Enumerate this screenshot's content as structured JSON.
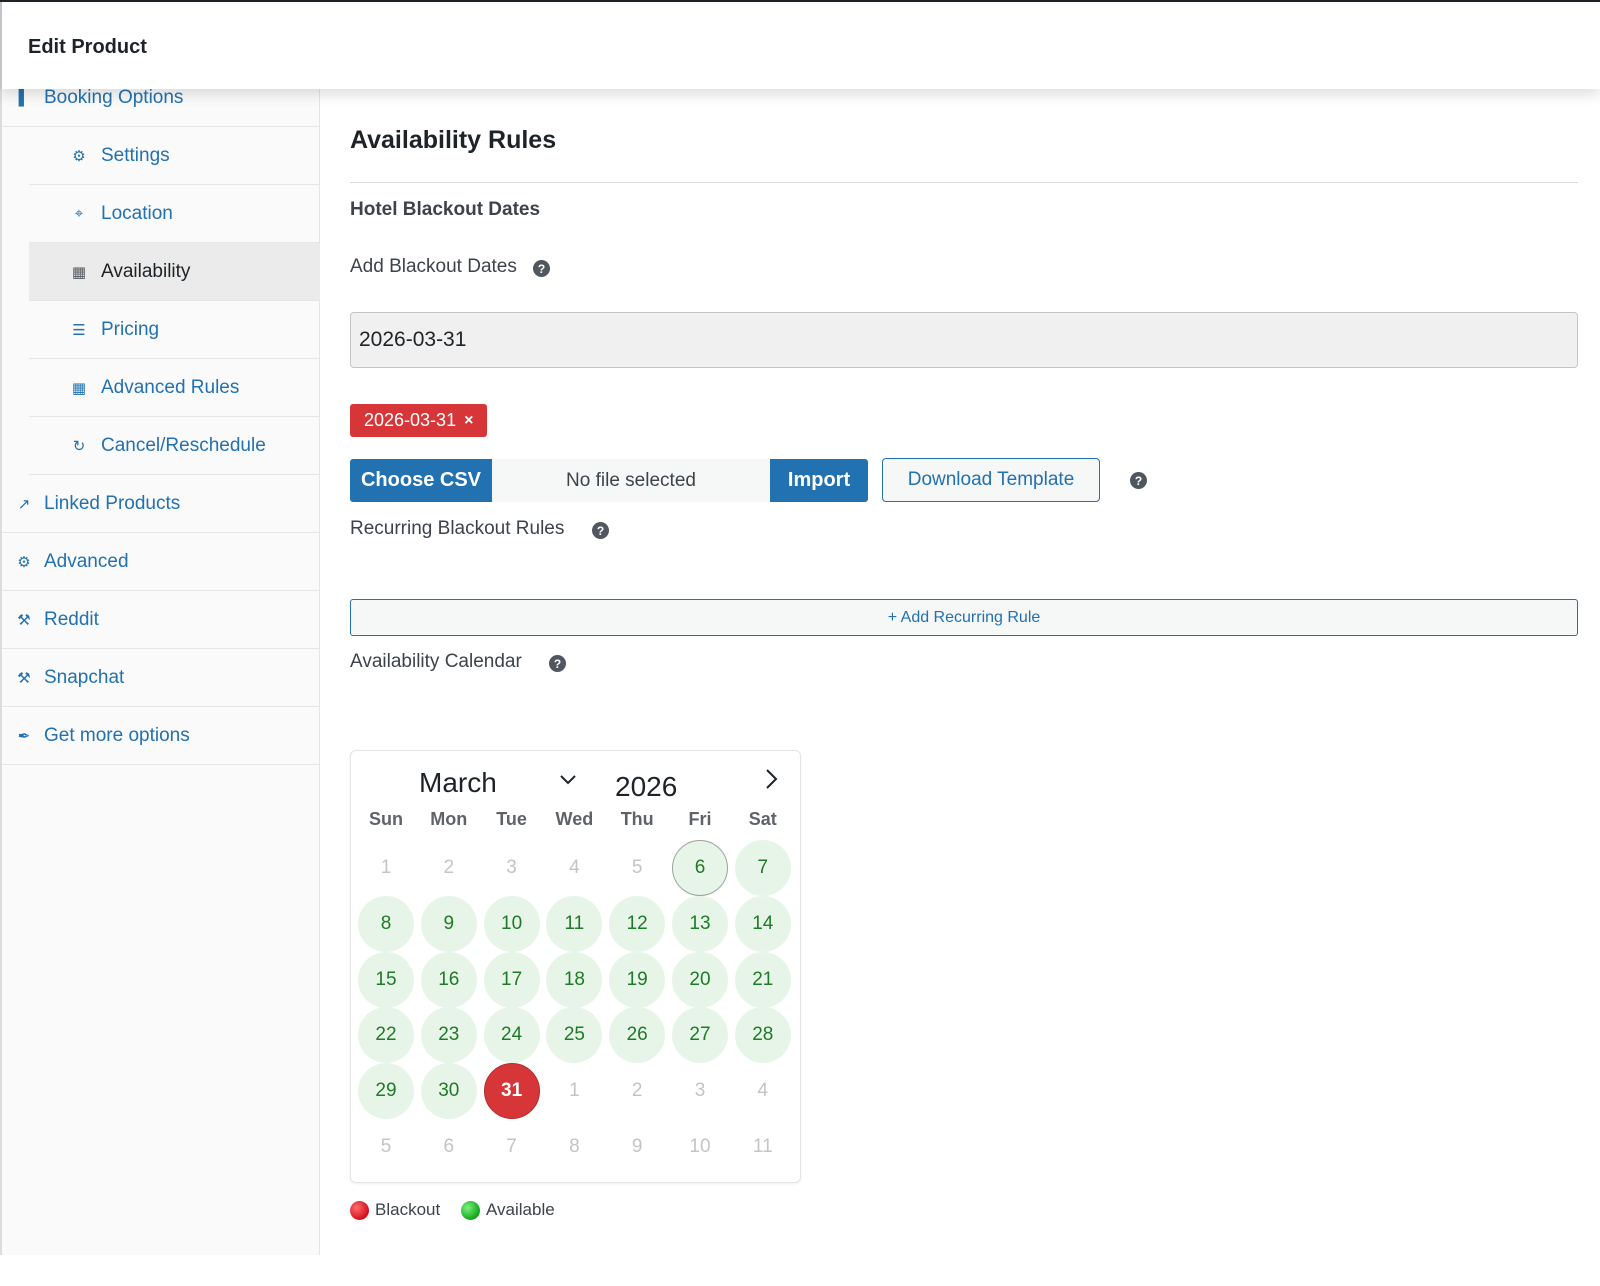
{
  "window": {
    "title": "Edit Product"
  },
  "sidebar": {
    "items": [
      {
        "label": "Booking Options",
        "icon": "book-icon",
        "level": "top"
      },
      {
        "label": "Settings",
        "icon": "gear-icon",
        "level": "sub"
      },
      {
        "label": "Location",
        "icon": "map-pin-icon",
        "level": "sub"
      },
      {
        "label": "Availability",
        "icon": "calendar-icon",
        "level": "sub",
        "active": true
      },
      {
        "label": "Pricing",
        "icon": "list-icon",
        "level": "sub"
      },
      {
        "label": "Advanced Rules",
        "icon": "grid-icon",
        "level": "sub"
      },
      {
        "label": "Cancel/Reschedule",
        "icon": "refresh-icon",
        "level": "sub"
      },
      {
        "label": "Linked Products",
        "icon": "link-icon",
        "level": "top"
      },
      {
        "label": "Advanced",
        "icon": "gear-icon",
        "level": "top"
      },
      {
        "label": "Reddit",
        "icon": "wrench-icon",
        "level": "top"
      },
      {
        "label": "Snapchat",
        "icon": "wrench-icon",
        "level": "top"
      },
      {
        "label": "Get more options",
        "icon": "plugin-icon",
        "level": "top"
      }
    ]
  },
  "main": {
    "section_title": "Availability Rules",
    "subsection_title": "Hotel Blackout Dates",
    "add_blackout_label": "Add Blackout Dates",
    "blackout_input_value": "2026-03-31",
    "blackout_tags": [
      {
        "label": "2026-03-31",
        "remove_symbol": "×"
      }
    ],
    "choose_csv_label": "Choose CSV",
    "file_status": "No file selected",
    "import_label": "Import",
    "download_template_label": "Download Template",
    "recurring_label": "Recurring Blackout Rules",
    "add_recurring_label": "+ Add Recurring Rule",
    "calendar_label": "Availability Calendar",
    "help_symbol": "?"
  },
  "calendar": {
    "month": "March",
    "year": "2026",
    "weekdays": [
      "Sun",
      "Mon",
      "Tue",
      "Wed",
      "Thu",
      "Fri",
      "Sat"
    ],
    "weeks": [
      [
        {
          "d": "1",
          "s": "other"
        },
        {
          "d": "2",
          "s": "other"
        },
        {
          "d": "3",
          "s": "other"
        },
        {
          "d": "4",
          "s": "other"
        },
        {
          "d": "5",
          "s": "other"
        },
        {
          "d": "6",
          "s": "today"
        },
        {
          "d": "7",
          "s": "avail"
        }
      ],
      [
        {
          "d": "8",
          "s": "avail"
        },
        {
          "d": "9",
          "s": "avail"
        },
        {
          "d": "10",
          "s": "avail"
        },
        {
          "d": "11",
          "s": "avail"
        },
        {
          "d": "12",
          "s": "avail"
        },
        {
          "d": "13",
          "s": "avail"
        },
        {
          "d": "14",
          "s": "avail"
        }
      ],
      [
        {
          "d": "15",
          "s": "avail"
        },
        {
          "d": "16",
          "s": "avail"
        },
        {
          "d": "17",
          "s": "avail"
        },
        {
          "d": "18",
          "s": "avail"
        },
        {
          "d": "19",
          "s": "avail"
        },
        {
          "d": "20",
          "s": "avail"
        },
        {
          "d": "21",
          "s": "avail"
        }
      ],
      [
        {
          "d": "22",
          "s": "avail"
        },
        {
          "d": "23",
          "s": "avail"
        },
        {
          "d": "24",
          "s": "avail"
        },
        {
          "d": "25",
          "s": "avail"
        },
        {
          "d": "26",
          "s": "avail"
        },
        {
          "d": "27",
          "s": "avail"
        },
        {
          "d": "28",
          "s": "avail"
        }
      ],
      [
        {
          "d": "29",
          "s": "avail"
        },
        {
          "d": "30",
          "s": "avail"
        },
        {
          "d": "31",
          "s": "blackout"
        },
        {
          "d": "1",
          "s": "other"
        },
        {
          "d": "2",
          "s": "other"
        },
        {
          "d": "3",
          "s": "other"
        },
        {
          "d": "4",
          "s": "other"
        }
      ],
      [
        {
          "d": "5",
          "s": "other"
        },
        {
          "d": "6",
          "s": "other"
        },
        {
          "d": "7",
          "s": "other"
        },
        {
          "d": "8",
          "s": "other"
        },
        {
          "d": "9",
          "s": "other"
        },
        {
          "d": "10",
          "s": "other"
        },
        {
          "d": "11",
          "s": "other"
        }
      ]
    ]
  },
  "legend": {
    "blackout": "Blackout",
    "available": "Available"
  },
  "colors": {
    "accent": "#2271b1",
    "blackout": "#d63638",
    "available_bg": "#e7f5e8",
    "available_text": "#1f7a27"
  }
}
